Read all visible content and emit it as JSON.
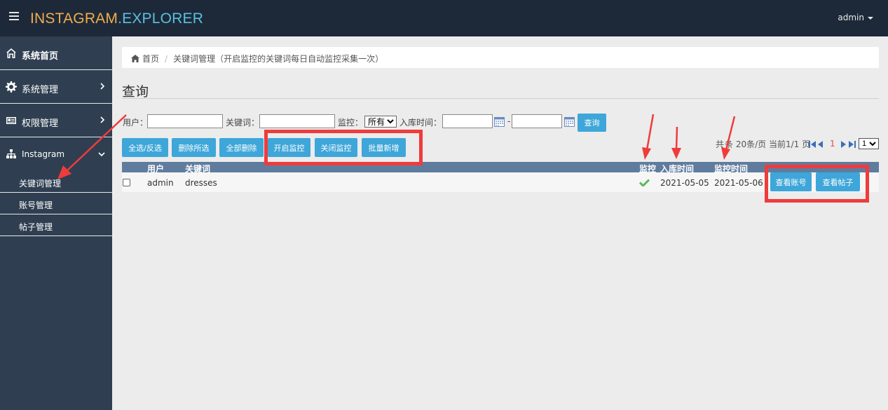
{
  "brand": {
    "part1": "INSTAGRAM",
    "part2": ".EXPLORER"
  },
  "user_menu": {
    "label": "admin"
  },
  "sidebar": {
    "items": [
      {
        "label": "系统首页",
        "icon": "home-icon"
      },
      {
        "label": "系统管理",
        "icon": "gear-icon"
      },
      {
        "label": "权限管理",
        "icon": "id-card-icon"
      },
      {
        "label": "Instagram",
        "icon": "sitemap-icon"
      }
    ],
    "subitems": [
      {
        "label": "关键词管理"
      },
      {
        "label": "账号管理"
      },
      {
        "label": "帖子管理"
      }
    ]
  },
  "breadcrumb": {
    "home": "首页",
    "current": "关键词管理（开启监控的关键词每日自动监控采集一次）"
  },
  "page_title": "查询",
  "filter": {
    "user_label": "用户：",
    "user_value": "",
    "keyword_label": "关键词：",
    "keyword_value": "",
    "monitor_label": "监控：",
    "monitor_selected": "所有",
    "date_label": "入库时间：",
    "date_sep": "-",
    "date_from": "",
    "date_to": "",
    "query_button": "查询"
  },
  "actions": {
    "select_all": "全选/反选",
    "delete_selected": "删除所选",
    "delete_all": "全部删除",
    "enable_monitor": "开启监控",
    "disable_monitor": "关闭监控",
    "batch_add": "批量新增"
  },
  "pager": {
    "summary_prefix": "共",
    "summary": "条 20条/页 当前1/1 页",
    "current_page": "1",
    "page_select": "1"
  },
  "table": {
    "headers": {
      "user": "用户",
      "keyword": "关键词",
      "monitor": "监控",
      "created": "入库时间",
      "monitor_time": "监控时间"
    },
    "rows": [
      {
        "user": "admin",
        "keyword": "dresses",
        "monitor_icon": "check-icon",
        "created": "2021-05-05",
        "monitor_time": "2021-05-06",
        "view_account": "查看账号",
        "view_posts": "查看帖子"
      }
    ]
  },
  "colors": {
    "topbar": "#1d2939",
    "sidebar": "#2f3f51",
    "button": "#3ea6d9",
    "table_header": "#5f7c9f",
    "annotation": "#f03b3b",
    "brand_orange": "#f0ad4e",
    "brand_blue": "#5bc0de"
  }
}
